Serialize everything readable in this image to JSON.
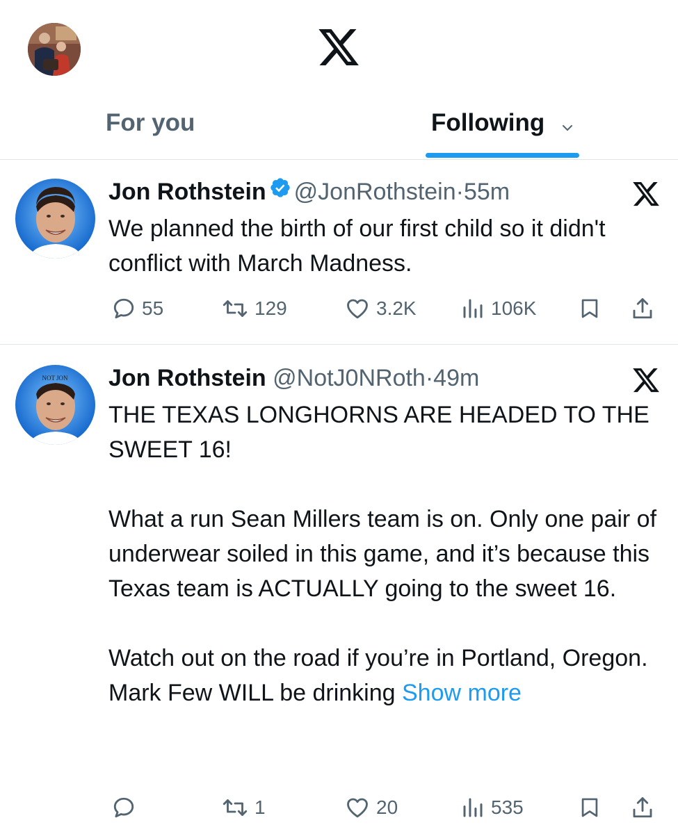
{
  "header": {
    "profile_avatar_icon": "profile-avatar",
    "logo_icon": "x-logo"
  },
  "tabs": [
    {
      "label": "For you"
    },
    {
      "label": "Following"
    }
  ],
  "tweets": [
    {
      "author": "Jon Rothstein",
      "verified": true,
      "handle": "@JonRothstein",
      "dot": "·",
      "time": "55m",
      "text": "We planned the birth of our first child so it didn't conflict with March Madness.",
      "show_more": "",
      "replies": "55",
      "retweets": "129",
      "likes": "3.2K",
      "views": "106K"
    },
    {
      "author": "Jon Rothstein",
      "verified": false,
      "handle": "@NotJ0NRoth",
      "dot": "·",
      "time": "49m",
      "avatar_caption": "NOT JON",
      "text": "THE TEXAS LONGHORNS ARE HEADED TO THE SWEET 16!\n\nWhat a run Sean Millers team is on. Only one pair of underwear soiled in this game, and it’s because this Texas team is ACTUALLY going to the sweet 16.\n\nWatch out on the road if you’re in Portland, Oregon. Mark Few WILL be drinking ",
      "show_more": "Show more",
      "replies": "",
      "retweets": "1",
      "likes": "20",
      "views": "535"
    }
  ],
  "colors": {
    "accent": "#1d9bf0",
    "muted": "#536471",
    "text": "#0f1419",
    "divider": "#e1e6ea"
  }
}
